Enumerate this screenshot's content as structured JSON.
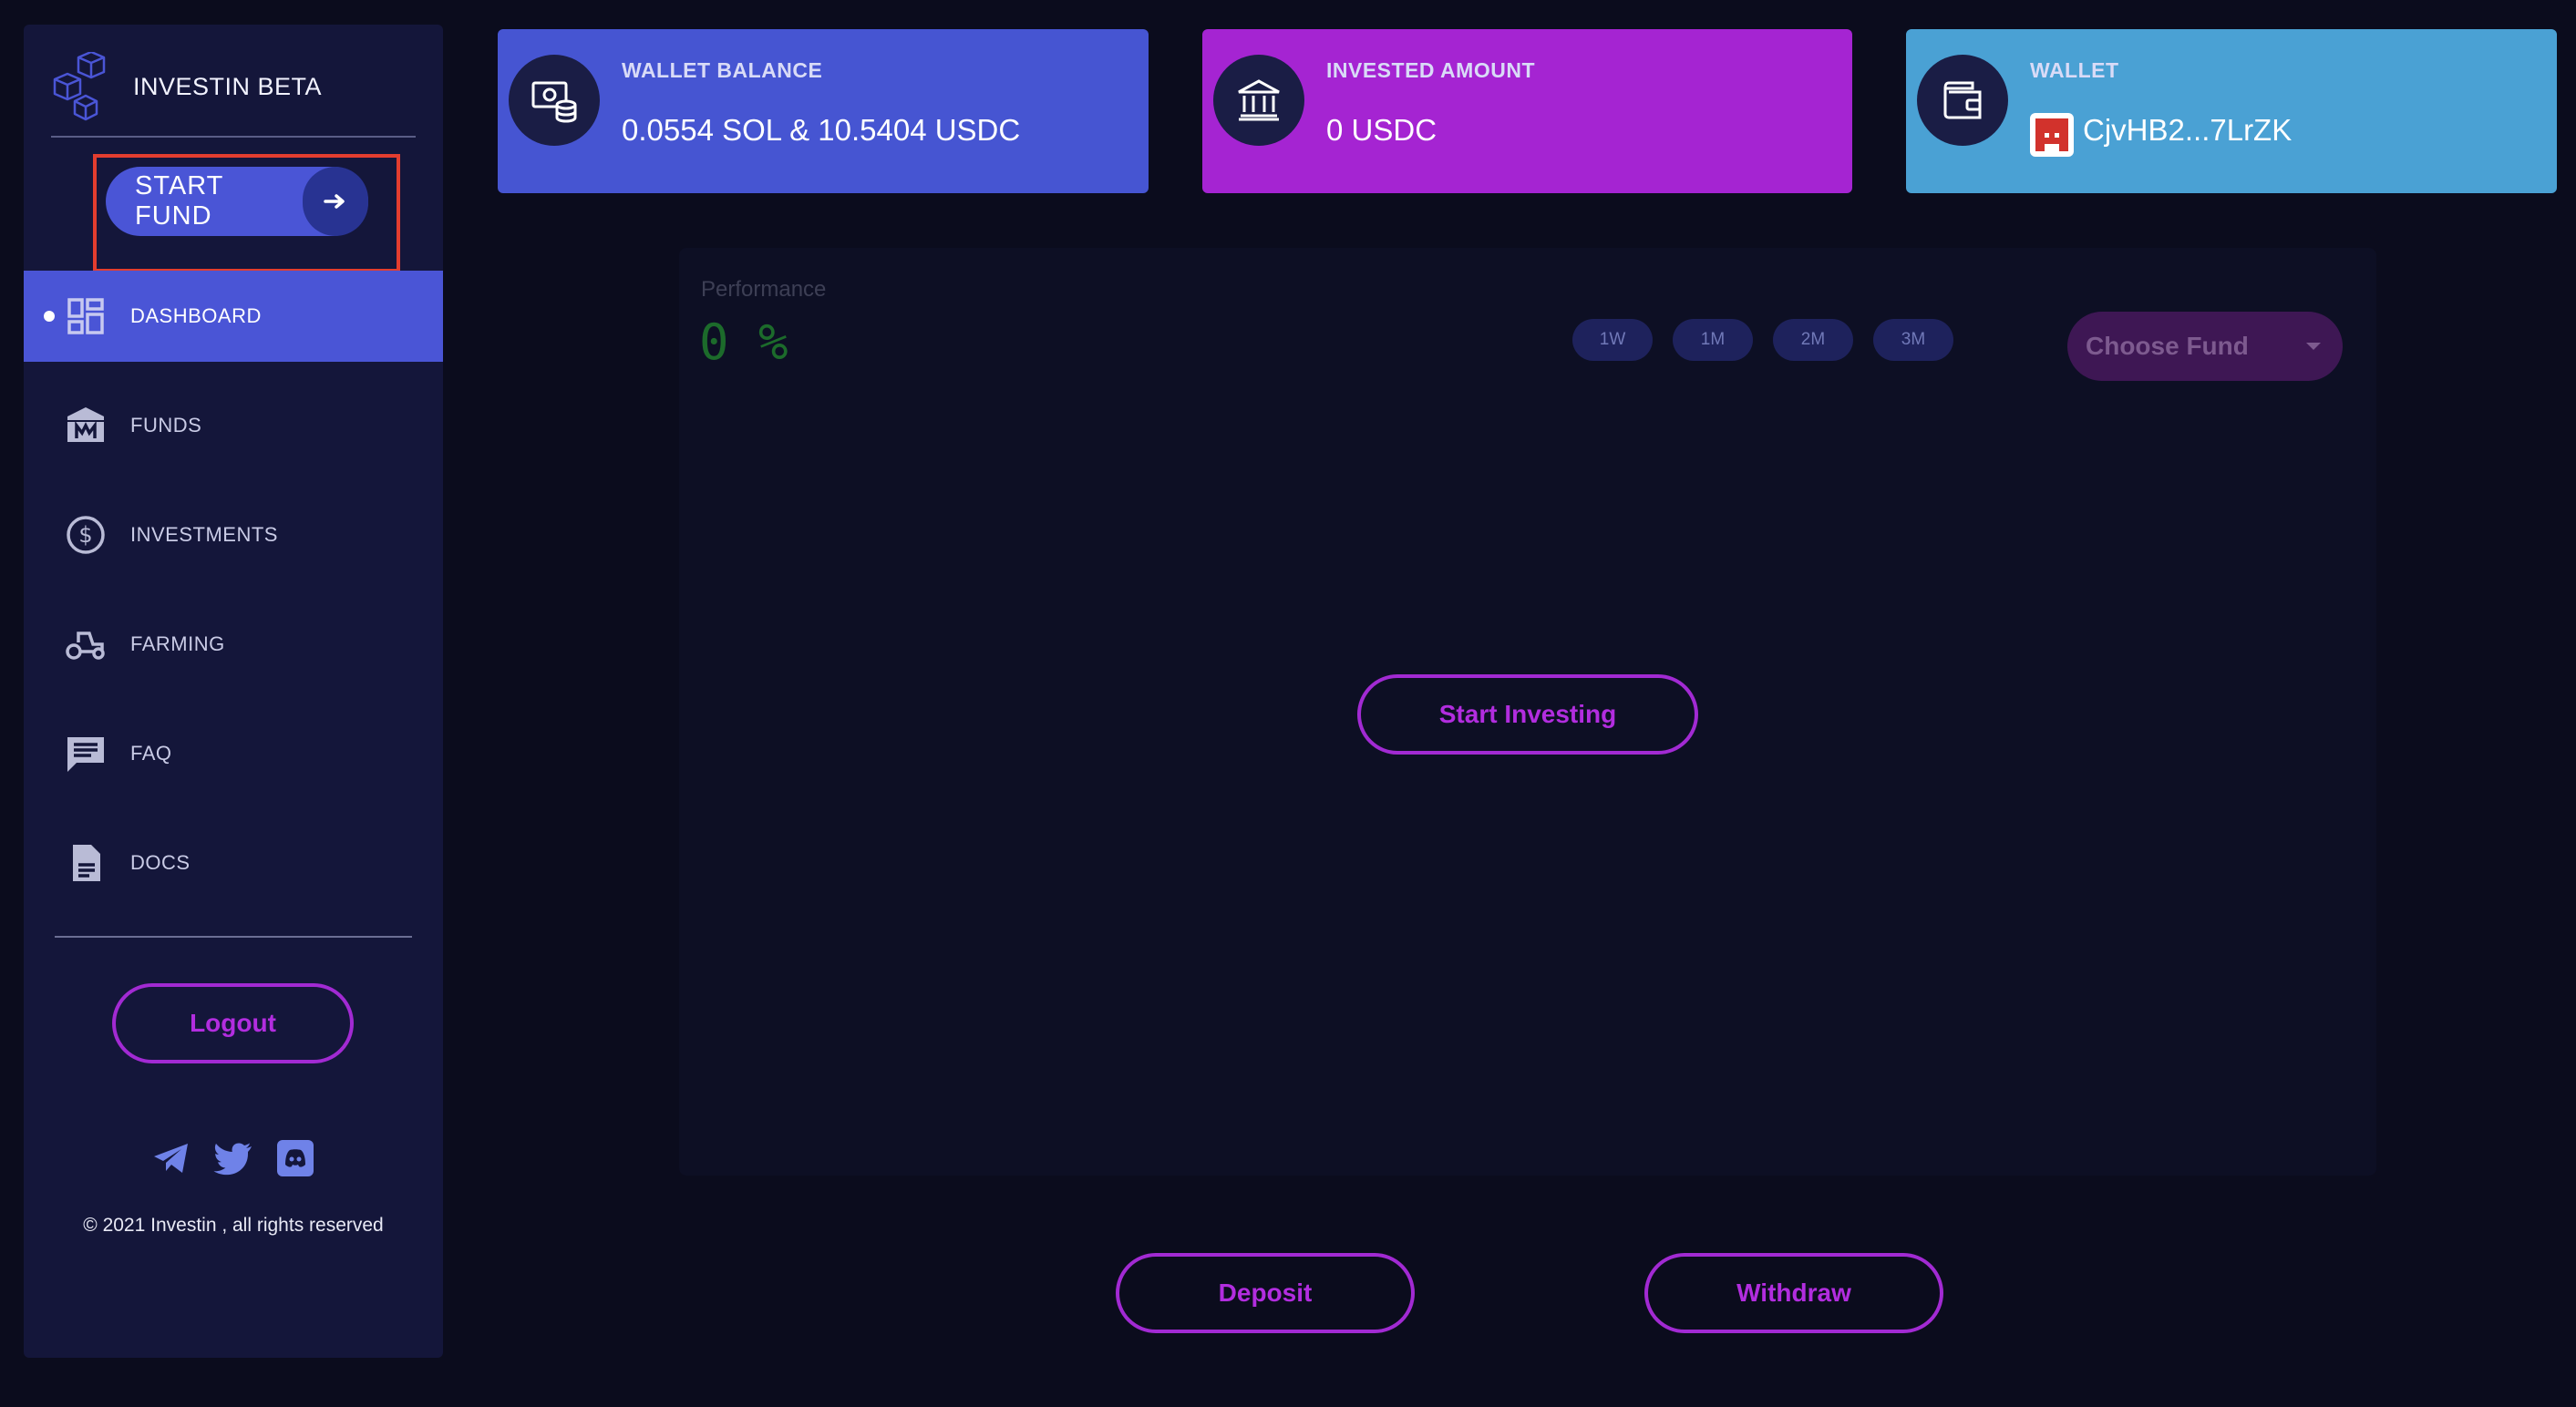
{
  "brand": {
    "name": "INVESTIN BETA",
    "logo_icon": "cubes-logo-icon"
  },
  "start_fund": {
    "label": "START FUND",
    "icon": "arrow-right-icon"
  },
  "nav": [
    {
      "label": "DASHBOARD",
      "icon": "dashboard-icon",
      "active": true
    },
    {
      "label": "FUNDS",
      "icon": "bank-icon",
      "active": false
    },
    {
      "label": "INVESTMENTS",
      "icon": "dollar-icon",
      "active": false
    },
    {
      "label": "FARMING",
      "icon": "tractor-icon",
      "active": false
    },
    {
      "label": "FAQ",
      "icon": "chat-icon",
      "active": false
    },
    {
      "label": "DOCS",
      "icon": "document-icon",
      "active": false
    }
  ],
  "logout_label": "Logout",
  "socials": [
    "telegram-icon",
    "twitter-icon",
    "discord-icon"
  ],
  "copyright": "© 2021 Investin , all rights reserved",
  "cards": {
    "wallet_balance": {
      "title": "WALLET BALANCE",
      "value": "0.0554 SOL & 10.5404 USDC",
      "icon": "cash-coins-icon"
    },
    "invested_amount": {
      "title": "INVESTED AMOUNT",
      "value": "0 USDC",
      "icon": "bank-icon"
    },
    "wallet": {
      "title": "WALLET",
      "value": "CjvHB2...7LrZK",
      "icon": "wallet-icon"
    }
  },
  "performance": {
    "label": "Performance",
    "value": "0 %",
    "ranges": [
      "1W",
      "1M",
      "2M",
      "3M"
    ],
    "choose_fund": "Choose Fund",
    "start_investing": "Start Investing"
  },
  "actions": {
    "deposit": "Deposit",
    "withdraw": "Withdraw"
  },
  "colors": {
    "background": "#0b0c1d",
    "sidebar": "#14163a",
    "accent_blue": "#4a55d6",
    "accent_purple": "#a524d2",
    "accent_cyan": "#4aa1d4",
    "button_outline": "#a22ad3"
  }
}
